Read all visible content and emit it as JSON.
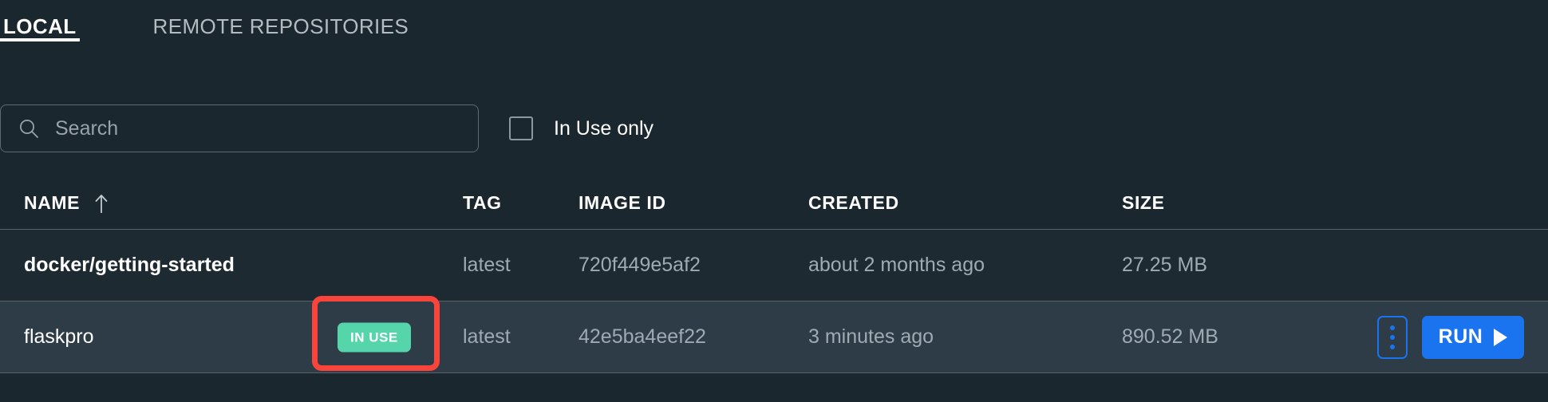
{
  "tabs": [
    {
      "label": "LOCAL",
      "active": true
    },
    {
      "label": "REMOTE REPOSITORIES",
      "active": false
    }
  ],
  "filters": {
    "search": {
      "value": "",
      "placeholder": "Search",
      "icon": "search-icon"
    },
    "in_use_only": {
      "label": "In Use only",
      "checked": false
    }
  },
  "table": {
    "columns": [
      {
        "key": "name",
        "label": "NAME",
        "sorted": true,
        "sort_direction": "asc"
      },
      {
        "key": "tag",
        "label": "TAG"
      },
      {
        "key": "image_id",
        "label": "IMAGE ID"
      },
      {
        "key": "created",
        "label": "CREATED"
      },
      {
        "key": "size",
        "label": "SIZE"
      }
    ],
    "rows": [
      {
        "name": "docker/getting-started",
        "tag": "latest",
        "image_id": "720f449e5af2",
        "created": "about 2 months ago",
        "size": "27.25 MB",
        "in_use": false,
        "selected": false
      },
      {
        "name": "flaskpro",
        "tag": "latest",
        "image_id": "42e5ba4eef22",
        "created": "3 minutes ago",
        "size": "890.52 MB",
        "in_use": true,
        "in_use_label": "IN USE",
        "selected": true
      }
    ]
  },
  "actions": {
    "kebab_label": "More options",
    "run_label": "RUN"
  },
  "colors": {
    "background": "#1b272e",
    "row_default": "#1e2a32",
    "row_selected": "#2e3c47",
    "divider": "#5a6268",
    "accent_blue": "#1a74f0",
    "badge_green": "#56d4aa",
    "annotation_red": "#f9443b",
    "text_primary": "#ffffff",
    "text_muted": "#9fabb3",
    "placeholder": "#97a2aa"
  }
}
